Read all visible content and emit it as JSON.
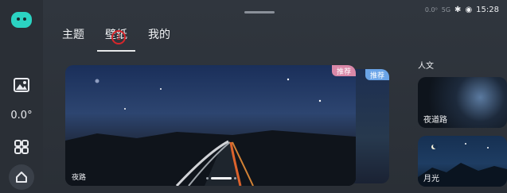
{
  "status_bar": {
    "speed": "0.0⁰",
    "time": "15:28",
    "network_label": "5G"
  },
  "sidebar": {
    "temperature": "0.0°"
  },
  "tabs": [
    {
      "label": "主题"
    },
    {
      "label": "壁纸"
    },
    {
      "label": "我的"
    }
  ],
  "tab_marker": "1",
  "featured": {
    "card_title": "夜路",
    "badge_main": "推荐",
    "badge_back": "推荐",
    "pager_count": 3,
    "pager_active": 1
  },
  "side_section": {
    "title": "人文",
    "items": [
      {
        "label": "夜道路"
      },
      {
        "label": "月光"
      }
    ]
  }
}
